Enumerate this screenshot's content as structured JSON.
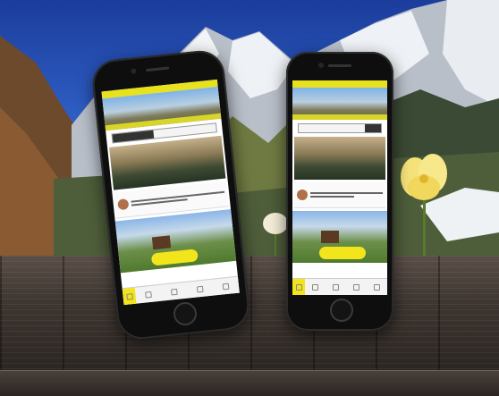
{
  "scene": {
    "description_free": true
  },
  "phones": [
    {
      "id": "left",
      "tabs": 5
    },
    {
      "id": "right",
      "tabs": 5
    }
  ],
  "colors": {
    "app_accent": "#e8e21c",
    "sky": "#1b3d9c",
    "table": "#3e3631"
  }
}
